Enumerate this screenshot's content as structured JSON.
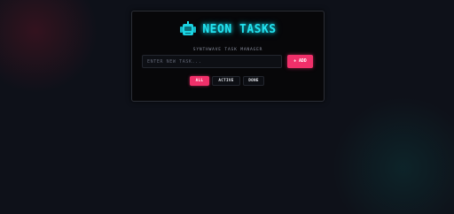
{
  "app": {
    "title": "NEON TASKS",
    "subtitle": "SYNTHWAVE TASK MANAGER",
    "icon": "robot-icon"
  },
  "input": {
    "placeholder": "ENTER NEW TASK...",
    "value": ""
  },
  "add_button": {
    "label": "+ ADD"
  },
  "filters": [
    {
      "label": "ALL",
      "selected": true
    },
    {
      "label": "ACTIVE",
      "selected": false
    },
    {
      "label": "DONE",
      "selected": false
    }
  ],
  "colors": {
    "accent_pink": "#f0306a",
    "neon_cyan": "#22e3f0",
    "background": "#0e1119",
    "card": "#070709"
  }
}
